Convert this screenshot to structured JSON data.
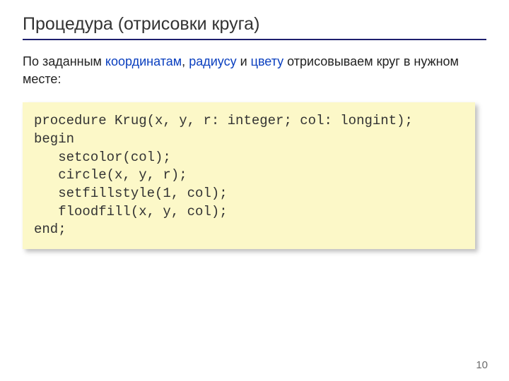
{
  "title": "Процедура (отрисовки круга)",
  "subtitle_parts": {
    "t1": "По заданным ",
    "hl1": "координатам",
    "sep1": ", ",
    "hl2": "радиусу",
    "sep2": " и ",
    "hl3": "цвету",
    "t2": " отрисовываем круг в нужном месте:"
  },
  "code": "procedure Krug(x, y, r: integer; col: longint);\nbegin\n   setcolor(col);\n   circle(x, y, r);\n   setfillstyle(1, col);\n   floodfill(x, y, col);\nend;",
  "page_number": "10"
}
